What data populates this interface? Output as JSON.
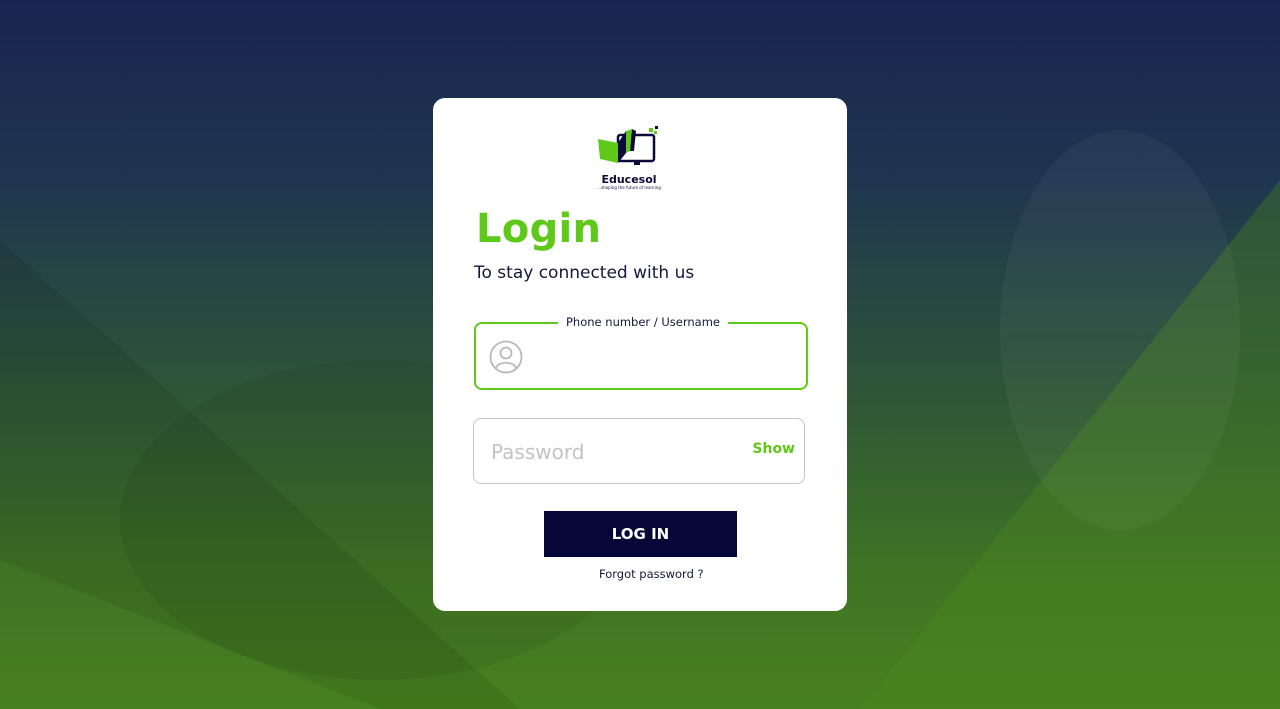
{
  "brand": {
    "name": "Educesol",
    "tagline": "...shaping the future of learning"
  },
  "login": {
    "title": "Login",
    "subtitle": "To stay connected with us"
  },
  "username_field": {
    "label": "Phone number  / Username",
    "value": ""
  },
  "password_field": {
    "placeholder": "Password",
    "show_label": "Show"
  },
  "actions": {
    "login_label": "LOG IN",
    "forgot_label": "Forgot password ?"
  },
  "colors": {
    "accent": "#5fc919",
    "navy": "#060638"
  }
}
